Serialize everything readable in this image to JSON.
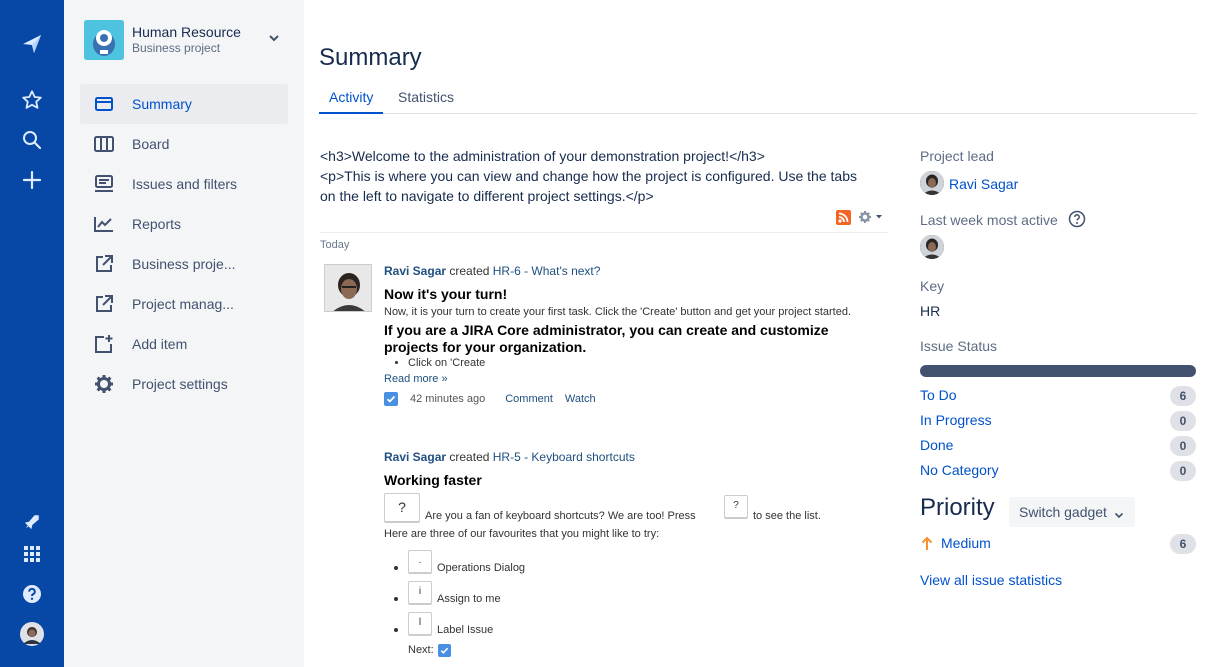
{
  "project": {
    "name": "Human Resource",
    "type": "Business project"
  },
  "sidebar": {
    "items": [
      {
        "label": "Summary",
        "icon": "summary-icon",
        "active": true
      },
      {
        "label": "Board",
        "icon": "board-icon"
      },
      {
        "label": "Issues and filters",
        "icon": "issues-icon"
      },
      {
        "label": "Reports",
        "icon": "reports-icon"
      },
      {
        "label": "Business proje...",
        "icon": "external-link-icon"
      },
      {
        "label": "Project manag...",
        "icon": "external-link-icon"
      },
      {
        "label": "Add item",
        "icon": "add-item-icon"
      },
      {
        "label": "Project settings",
        "icon": "gear-icon"
      }
    ]
  },
  "page": {
    "title": "Summary",
    "tabs": [
      "Activity",
      "Statistics"
    ],
    "active_tab": "Activity"
  },
  "description": {
    "line1": "<h3>Welcome to the administration of your demonstration project!</h3>",
    "line2": "<p>This is where you can view and change how the project is configured. Use the tabs",
    "line3": "on the left to navigate to different project settings.</p>"
  },
  "activity": {
    "day_label": "Today",
    "entries": [
      {
        "user": "Ravi Sagar",
        "verb": "created",
        "issue": "HR-6 - What's next?",
        "heading": "Now it's your turn!",
        "body": "Now, it is your turn to create your first task. Click the 'Create' button and get your project started.",
        "subheading": "If you are a JIRA Core administrator, you can create and customize projects for your organization.",
        "bullet": "Click on 'Create",
        "read_more": "Read more »",
        "time": "42 minutes ago",
        "comment": "Comment",
        "watch": "Watch"
      },
      {
        "user": "Ravi Sagar",
        "verb": "created",
        "issue": "HR-5 - Keyboard shortcuts",
        "heading": "Working faster",
        "key_large": "?",
        "text_before_key": "Are you a fan of keyboard shortcuts? We are too! Press",
        "key_inline": "?",
        "text_after_key": "to see the list.",
        "intro": "Here are three of our favourites that you might like to try:",
        "favourites": [
          {
            "key": ".",
            "label": "Operations Dialog"
          },
          {
            "key": "i",
            "label": "Assign to me"
          },
          {
            "key": "l",
            "label": "Label Issue"
          }
        ],
        "next_label": "Next:"
      }
    ]
  },
  "details": {
    "project_lead_label": "Project lead",
    "project_lead": "Ravi Sagar",
    "most_active_label": "Last week most active",
    "key_label": "Key",
    "key": "HR",
    "issue_status_label": "Issue Status",
    "statuses": [
      {
        "label": "To Do",
        "count": "6"
      },
      {
        "label": "In Progress",
        "count": "0"
      },
      {
        "label": "Done",
        "count": "0"
      },
      {
        "label": "No Category",
        "count": "0"
      }
    ],
    "priority_title": "Priority",
    "switch_gadget": "Switch gadget",
    "priorities": [
      {
        "label": "Medium",
        "count": "6",
        "color": "#f79232"
      }
    ],
    "view_all": "View all issue statistics"
  },
  "colors": {
    "rail": "#0747a6",
    "sidebar": "#f4f5f7",
    "link": "#0052cc",
    "status_bar": "#42526e"
  }
}
